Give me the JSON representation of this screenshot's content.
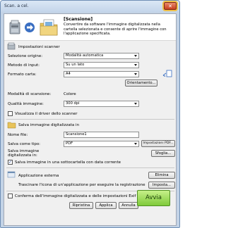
{
  "window": {
    "title": "Scan. a cel."
  },
  "header": {
    "title": "[Scansione]",
    "description": "Convertire da software l'immagine digitalizzata nella cartella selezionata e consente di aprire l'immagine con l'applicazione specificata."
  },
  "scanner_settings": {
    "section_label": "Impostazioni scanner",
    "select_source_label": "Selezione origine:",
    "select_source_value": "Modalità automatica",
    "input_method_label": "Metodo di input:",
    "input_method_value": "Su un lato",
    "paper_size_label": "Formato carta:",
    "paper_size_value": "A4",
    "orientation_button": "Orientamento...",
    "scan_mode_label": "Modalità di scansione:",
    "scan_mode_value": "Colore",
    "quality_label": "Qualità immagine:",
    "quality_value": "300 dpi",
    "show_driver_label": "Visualizza il driver dello scanner",
    "show_driver_checked": false
  },
  "save_settings": {
    "section_label": "Salva immagine digitalizzata in",
    "file_name_label": "Nome file:",
    "file_name_value": "Scansione1",
    "save_as_label": "Salva come tipo:",
    "save_as_value": "PDF",
    "pdf_settings_button": "Impostazioni PDF...",
    "save_in_label_line1": "Salva immagine",
    "save_in_label_line2": "digitalizzata in:",
    "browse_button": "Sfoglia...",
    "subfolder_label": "Salva immagine in una sottocartella con data corrente",
    "subfolder_checked": true
  },
  "external_app": {
    "section_label": "Applicazione esterna",
    "hint": "Trascinare l'icona di un'applicazione per eseguire la registrazione",
    "delete_button": "Elimina",
    "settings_button": "Imposta..."
  },
  "footer": {
    "confirm_label": "Conferma dell'immagine digitalizzata e delle impostazioni Exif",
    "confirm_checked": false,
    "reset_button": "Ripristina",
    "apply_button": "Applica",
    "cancel_button": "Annulla",
    "start_button": "Avvia"
  },
  "icons": {
    "close": "close-icon",
    "scanner": "scanner-icon",
    "arrow": "arrow-right-icon",
    "folder": "folder-icon",
    "paper_orientation": "paper-orientation-icon"
  },
  "colors": {
    "title_bar": "#c4d5ea",
    "close_button": "#c8401f",
    "start_button": "#7fca3a",
    "accent_blue": "#3a6fc2"
  }
}
